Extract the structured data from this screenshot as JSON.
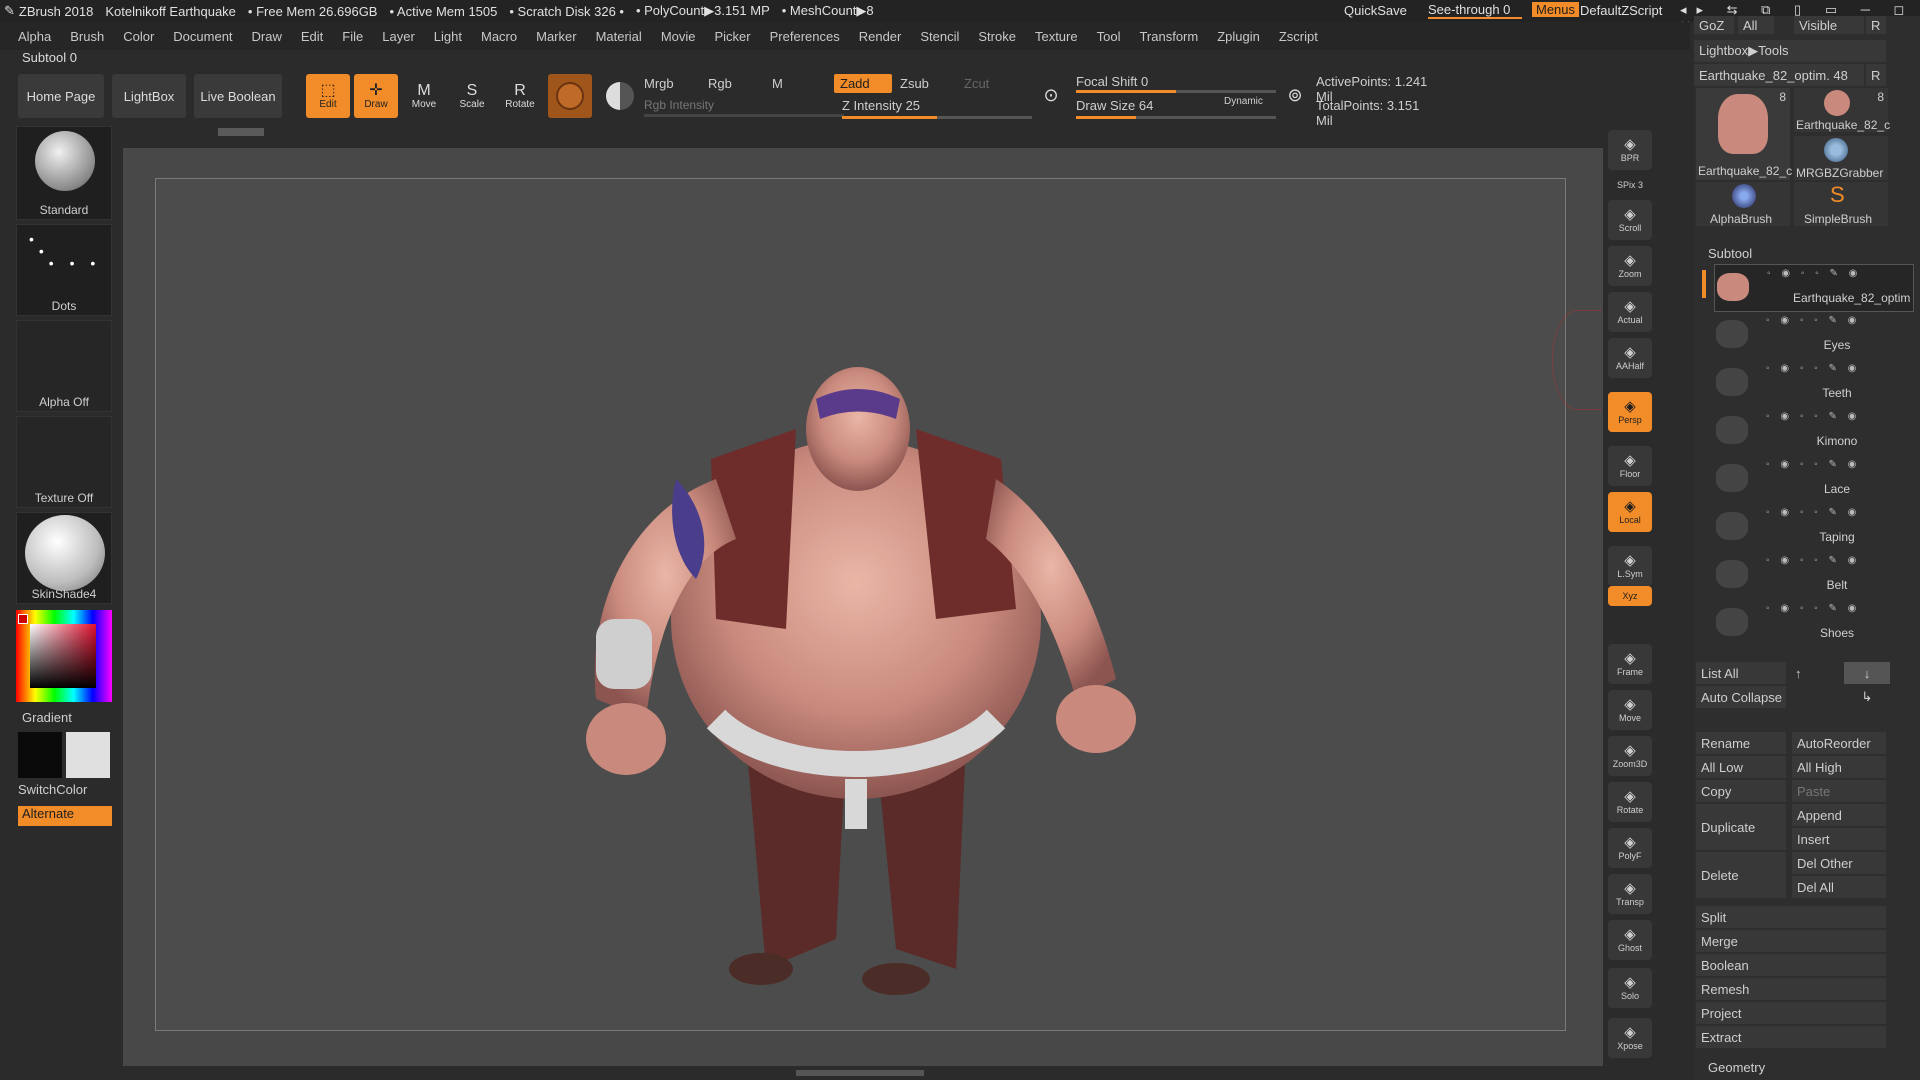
{
  "title": {
    "app": "ZBrush 2018",
    "doc": "Kotelnikoff Earthquake",
    "free_mem": "• Free Mem 26.696GB",
    "active_mem": "• Active Mem 1505",
    "scratch": "• Scratch Disk 326 •",
    "polycount": "• PolyCount▶3.151 MP",
    "meshcount": "• MeshCount▶8",
    "quicksave": "QuickSave",
    "seethrough": "See-through  0",
    "menus": "Menus",
    "script": "DefaultZScript"
  },
  "menubar": [
    "Alpha",
    "Brush",
    "Color",
    "Document",
    "Draw",
    "Edit",
    "File",
    "Layer",
    "Light",
    "Macro",
    "Marker",
    "Material",
    "Movie",
    "Picker",
    "Preferences",
    "Render",
    "Stencil",
    "Stroke",
    "Texture",
    "Tool",
    "Transform",
    "Zplugin",
    "Zscript"
  ],
  "subtool_label": "Subtool 0",
  "toolbar": {
    "home": "Home Page",
    "lightbox": "LightBox",
    "liveboolean": "Live Boolean",
    "edit": "Edit",
    "draw": "Draw",
    "move": "Move",
    "scale": "Scale",
    "rotate": "Rotate",
    "mrgb": "Mrgb",
    "rgb": "Rgb",
    "m": "M",
    "rgb_intensity": "Rgb Intensity",
    "zadd": "Zadd",
    "zsub": "Zsub",
    "zcut": "Zcut",
    "z_intensity": "Z Intensity 25",
    "z_intensity_value": 0.5,
    "focal_shift": "Focal Shift 0",
    "focal_shift_value": 0.5,
    "draw_size": "Draw Size 64",
    "draw_size_value": 0.3,
    "dynamic": "Dynamic",
    "active_points": "ActivePoints: 1.241 Mil",
    "total_points": "TotalPoints: 3.151 Mil"
  },
  "left": {
    "brush": "Standard",
    "stroke": "Dots",
    "alpha": "Alpha Off",
    "texture": "Texture Off",
    "material": "SkinShade4",
    "gradient": "Gradient",
    "switchcolor": "SwitchColor",
    "alternate": "Alternate"
  },
  "rightbar": [
    {
      "name": "bpr",
      "label": "BPR",
      "orange": false
    },
    {
      "name": "spix",
      "label": "SPix 3",
      "orange": false
    },
    {
      "name": "scroll",
      "label": "Scroll",
      "orange": false
    },
    {
      "name": "zoom",
      "label": "Zoom",
      "orange": false
    },
    {
      "name": "actual",
      "label": "Actual",
      "orange": false
    },
    {
      "name": "aahalf",
      "label": "AAHalf",
      "orange": false
    },
    {
      "name": "persp",
      "label": "Persp",
      "orange": true
    },
    {
      "name": "floor",
      "label": "Floor",
      "orange": false
    },
    {
      "name": "local",
      "label": "Local",
      "orange": true
    },
    {
      "name": "lsym",
      "label": "L.Sym",
      "orange": false
    },
    {
      "name": "xyz",
      "label": "Xyz",
      "orange": true
    },
    {
      "name": "frame",
      "label": "Frame",
      "orange": false
    },
    {
      "name": "move",
      "label": "Move",
      "orange": false
    },
    {
      "name": "zoom3d",
      "label": "Zoom3D",
      "orange": false
    },
    {
      "name": "rotate",
      "label": "Rotate",
      "orange": false
    },
    {
      "name": "polyf",
      "label": "PolyF",
      "orange": false
    },
    {
      "name": "transp",
      "label": "Transp",
      "orange": false
    },
    {
      "name": "ghost",
      "label": "Ghost",
      "orange": false
    },
    {
      "name": "solo",
      "label": "Solo",
      "orange": false
    },
    {
      "name": "xpose",
      "label": "Xpose",
      "orange": false
    }
  ],
  "panel": {
    "goz": "GoZ",
    "all": "All",
    "visible": "Visible",
    "r": "R",
    "lightbox_tools": "Lightbox▶Tools",
    "tool_name": "Earthquake_82_optim. 48",
    "tools": [
      "Earthquake_82_c",
      "Earthquake_82_c",
      "MRGBZGrabber",
      "AlphaBrush",
      "SimpleBrush"
    ],
    "count_8a": "8",
    "count_8b": "8",
    "subtool_header": "Subtool",
    "subtools": [
      "Earthquake_82_optim",
      "Eyes",
      "Teeth",
      "Kimono",
      "Lace",
      "Taping",
      "Belt",
      "Shoes"
    ],
    "list_all": "List All",
    "auto_collapse": "Auto Collapse",
    "rename": "Rename",
    "autoreorder": "AutoReorder",
    "all_low": "All Low",
    "all_high": "All High",
    "copy": "Copy",
    "paste": "Paste",
    "duplicate": "Duplicate",
    "append": "Append",
    "insert": "Insert",
    "delete": "Delete",
    "del_other": "Del Other",
    "del_all": "Del All",
    "split": "Split",
    "merge": "Merge",
    "boolean": "Boolean",
    "remesh": "Remesh",
    "project": "Project",
    "extract": "Extract",
    "geometry": "Geometry"
  },
  "colors": {
    "accent": "#f28c28",
    "bg": "#2b2b2b",
    "viewport": "#484848"
  }
}
